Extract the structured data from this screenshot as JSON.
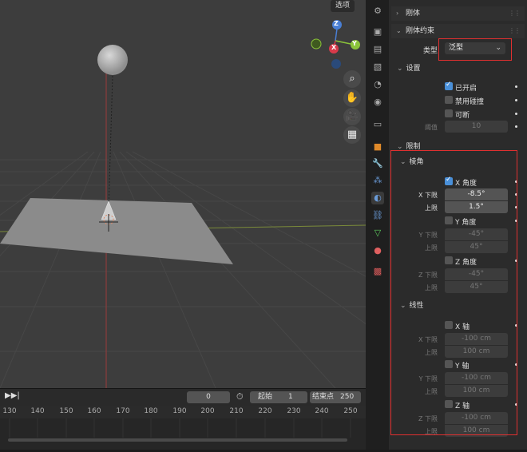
{
  "viewport": {
    "options_label": "选项",
    "nav_buttons": [
      "zoom-icon",
      "hand-pan-icon",
      "camera-icon",
      "grid-ortho-icon"
    ],
    "gizmo": {
      "z": "Z",
      "y": "Y",
      "x": "X"
    }
  },
  "timeline": {
    "current_frame": "0",
    "start_label": "起始",
    "start_value": "1",
    "end_label": "结束点",
    "end_value": "250",
    "ruler_ticks": [
      "130",
      "140",
      "150",
      "160",
      "170",
      "180",
      "190",
      "200",
      "210",
      "220",
      "230",
      "240",
      "250"
    ]
  },
  "properties": {
    "rigid_body": {
      "label": "刚体"
    },
    "constraint": {
      "label": "刚体约束",
      "type_label": "类型",
      "type_value": "泛型"
    },
    "settings": {
      "label": "设置",
      "enabled_label": "已开启",
      "disable_collisions_label": "禁用碰撞",
      "breakable_label": "可断",
      "threshold_label": "阈值",
      "threshold_value": "10"
    },
    "limits": {
      "label": "限制",
      "angular": {
        "label": "棱角",
        "x": {
          "label": "X 角度",
          "lower_label": "X 下限",
          "upper_label": "上限",
          "lower": "-8.5°",
          "upper": "1.5°"
        },
        "y": {
          "label": "Y 角度",
          "lower_label": "Y 下限",
          "upper_label": "上限",
          "lower": "-45°",
          "upper": "45°"
        },
        "z": {
          "label": "Z 角度",
          "lower_label": "Z 下限",
          "upper_label": "上限",
          "lower": "-45°",
          "upper": "45°"
        }
      },
      "linear": {
        "label": "线性",
        "x": {
          "label": "X 轴",
          "lower_label": "X 下限",
          "upper_label": "上限",
          "lower": "-100 cm",
          "upper": "100 cm"
        },
        "y": {
          "label": "Y 轴",
          "lower_label": "Y 下限",
          "upper_label": "上限",
          "lower": "-100 cm",
          "upper": "100 cm"
        },
        "z": {
          "label": "Z 轴",
          "lower_label": "Z 下限",
          "upper_label": "上限",
          "lower": "-100 cm",
          "upper": "100 cm"
        }
      }
    }
  },
  "colors": {
    "accent_blue": "#4a90d9",
    "annotation_red": "#e03030"
  }
}
